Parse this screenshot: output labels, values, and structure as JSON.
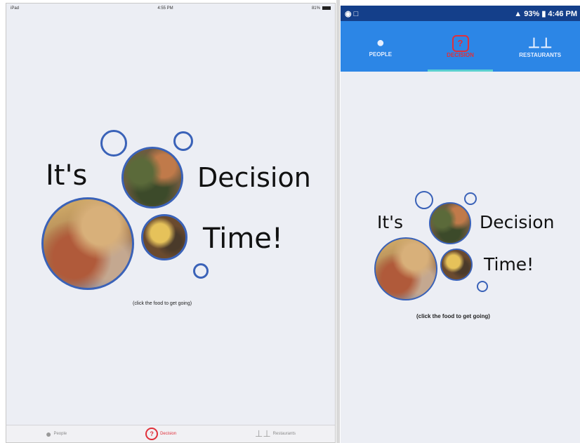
{
  "ipad": {
    "status": {
      "device": "iPad",
      "time": "4:55 PM",
      "battery": "81%"
    },
    "headline": {
      "word1": "It's",
      "word2": "Decision",
      "word3": "Time!"
    },
    "hint": "(click the food to get going)",
    "tabs": [
      {
        "label": "People",
        "icon": "person-icon"
      },
      {
        "label": "Decision",
        "icon": "question-icon"
      },
      {
        "label": "Restaurants",
        "icon": "fork-knife-icon"
      }
    ]
  },
  "android": {
    "status": {
      "signal": "93%",
      "time": "4:46 PM"
    },
    "tabs": [
      {
        "label": "PEOPLE",
        "icon": "person-icon"
      },
      {
        "label": "DECISION",
        "icon": "question-icon"
      },
      {
        "label": "RESTAURANTS",
        "icon": "fork-knife-icon"
      }
    ],
    "headline": {
      "word1": "It's",
      "word2": "Decision",
      "word3": "Time!"
    },
    "hint": "(click the food to get going)"
  },
  "colors": {
    "accent_blue": "#2c86e6",
    "ring_blue": "#3a62b8",
    "active_red": "#e0303a",
    "background": "#eceef4"
  }
}
